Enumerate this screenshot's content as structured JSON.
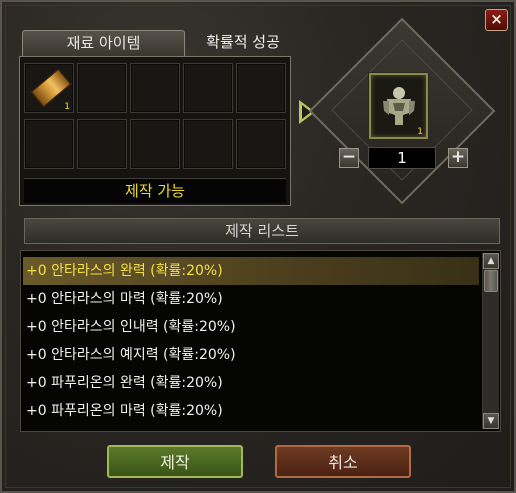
{
  "window": {
    "close_icon": "×"
  },
  "tabs": {
    "material": "재료 아이템",
    "success": "확률적 성공"
  },
  "materials": {
    "slot1_qty": "1",
    "status": "제작 가능"
  },
  "result": {
    "qty_badge": "1",
    "quantity": "1",
    "minus": "−",
    "plus": "+"
  },
  "craft_list": {
    "header": "제작 리스트",
    "items": [
      "+0 안타라스의 완력 (확률:20%)",
      "+0 안타라스의 마력 (확률:20%)",
      "+0 안타라스의 인내력 (확률:20%)",
      "+0 안타라스의 예지력 (확률:20%)",
      "+0 파푸리온의 완력 (확률:20%)",
      "+0 파푸리온의 마력 (확률:20%)"
    ],
    "scroll_up": "▲",
    "scroll_down": "▼"
  },
  "buttons": {
    "craft": "제작",
    "cancel": "취소"
  },
  "colors": {
    "selected_text": "#f4e04a",
    "status_text": "#eedd2a",
    "craft_button": "#5a7a2a",
    "cancel_button": "#6e3a22"
  }
}
